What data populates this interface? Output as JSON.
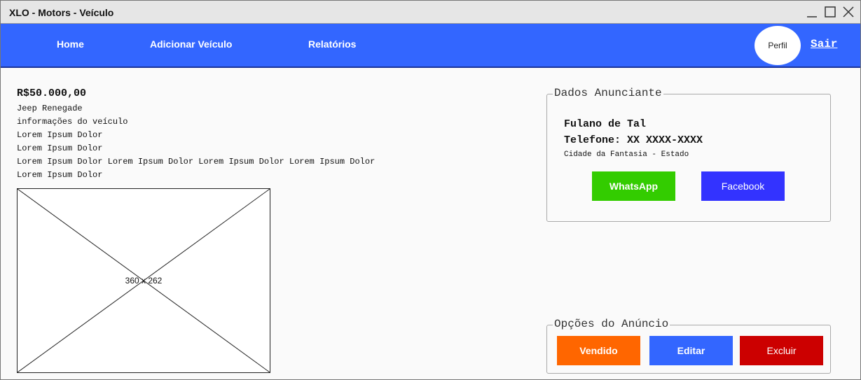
{
  "window": {
    "title": "XLO - Motors - Veículo"
  },
  "nav": {
    "home": "Home",
    "add_vehicle": "Adicionar Veículo",
    "reports": "Relatórios",
    "profile": "Perfil",
    "logout": "Sair"
  },
  "vehicle": {
    "price": "R$50.000,00",
    "name": "Jeep Renegade",
    "info_lines": [
      "informações do veículo",
      "Lorem Ipsum Dolor",
      "Lorem Ipsum Dolor",
      "Lorem Ipsum Dolor Lorem Ipsum Dolor Lorem Ipsum Dolor Lorem Ipsum Dolor",
      "Lorem Ipsum Dolor"
    ],
    "image_placeholder": "360 x 262"
  },
  "advertiser": {
    "legend": "Dados Anunciante",
    "name": "Fulano de Tal",
    "phone": "Telefone: XX XXXX-XXXX",
    "location": "Cidade da Fantasia - Estado",
    "whatsapp_label": "WhatsApp",
    "facebook_label": "Facebook"
  },
  "options": {
    "legend": "Opções do Anúncio",
    "sold_label": "Vendido",
    "edit_label": "Editar",
    "delete_label": "Excluir"
  },
  "colors": {
    "navbar": "#3366ff",
    "whatsapp": "#33cc00",
    "facebook": "#3333ff",
    "sold": "#ff6600",
    "edit": "#3366ff",
    "delete": "#cc0000"
  }
}
